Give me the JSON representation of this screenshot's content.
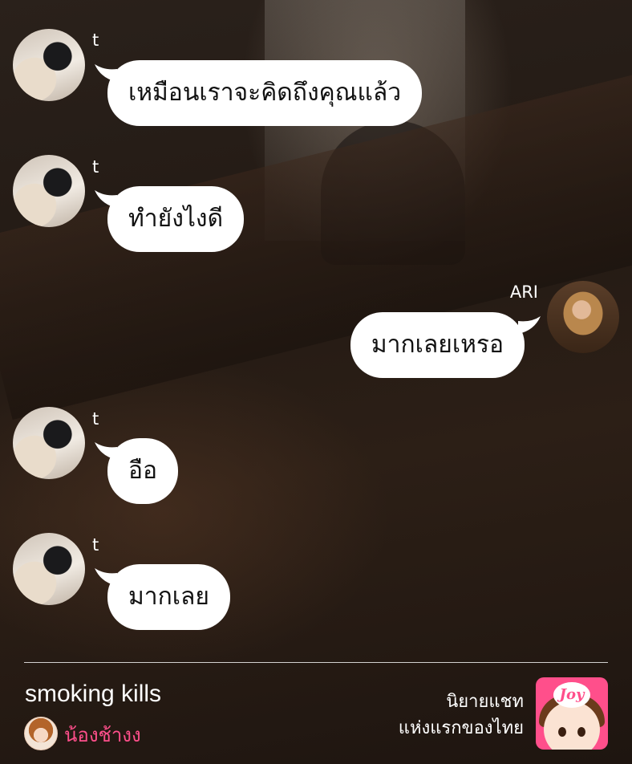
{
  "messages": [
    {
      "sender": "t",
      "text": "เหมือนเราจะคิดถึงคุณแล้ว"
    },
    {
      "sender": "t",
      "text": "ทำยังไงดี"
    },
    {
      "sender": "ARI",
      "text": "มากเลยเหรอ"
    },
    {
      "sender": "t",
      "text": "อือ"
    },
    {
      "sender": "t",
      "text": "มากเลย"
    }
  ],
  "footer": {
    "story_title": "smoking kills",
    "author_name": "น้องช้างง",
    "tagline_line1": "นิยายแชท",
    "tagline_line2": "แห่งแรกของไทย",
    "logo_text": "Joy"
  },
  "colors": {
    "bubble": "#ffffff",
    "author_accent": "#ff4f8b",
    "logo_bg": "#ff4f8b"
  },
  "icons": [
    "avatar-t",
    "avatar-ari",
    "author-avatar",
    "joylada-logo"
  ]
}
